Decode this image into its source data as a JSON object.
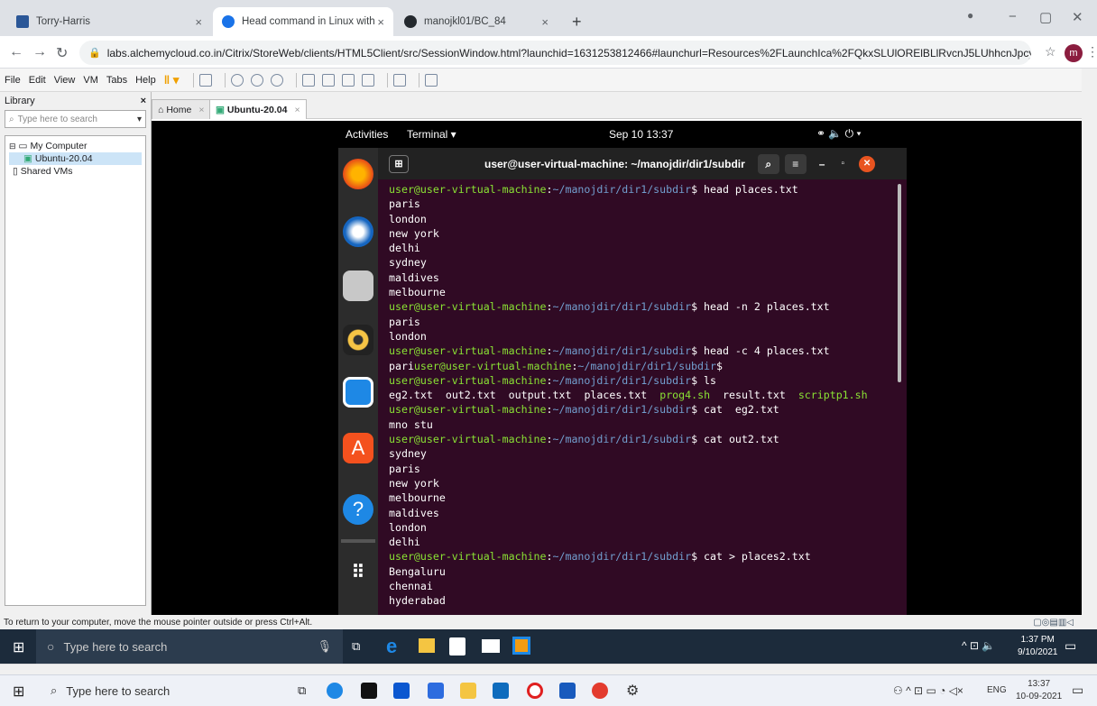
{
  "browser": {
    "tabs": [
      {
        "label": "Torry-Harris",
        "color": "#2b5797"
      },
      {
        "label": "Head command in Linux with exa",
        "color": "#1a73e8"
      },
      {
        "label": "manojkl01/BC_84",
        "color": "#24292e"
      }
    ],
    "new_tab": "+",
    "url": "labs.alchemycloud.co.in/Citrix/StoreWeb/clients/HTML5Client/src/SessionWindow.html?launchid=1631253812466#launchurl=Resources%2FLaunchIca%2FQkxSLUlORElBLlRvcnJ5LUhhcnJpcyAkQTlxLTlxLTFEO...",
    "profile_initial": "m"
  },
  "vmware": {
    "menu": [
      "File",
      "Edit",
      "View",
      "VM",
      "Tabs",
      "Help"
    ],
    "library": {
      "title": "Library",
      "search_placeholder": "Type here to search",
      "tree": [
        "My Computer",
        "Ubuntu-20.04",
        "Shared VMs"
      ]
    },
    "tabs": [
      {
        "label": "Home"
      },
      {
        "label": "Ubuntu-20.04"
      }
    ],
    "status_message": "To return to your computer, move the mouse pointer outside or press Ctrl+Alt."
  },
  "ubuntu": {
    "activities": "Activities",
    "app_menu": "Terminal ▾",
    "clock": "Sep 10  13:37",
    "terminal_title": "user@user-virtual-machine: ~/manojdir/dir1/subdir",
    "prompt_user": "user@user-virtual-machine",
    "prompt_path": "~/manojdir/dir1/subdir",
    "lines": [
      {
        "kind": "prompt",
        "cmd": "head places.txt"
      },
      {
        "kind": "out",
        "text": "paris"
      },
      {
        "kind": "out",
        "text": "london"
      },
      {
        "kind": "out",
        "text": "new york"
      },
      {
        "kind": "out",
        "text": "delhi"
      },
      {
        "kind": "out",
        "text": "sydney"
      },
      {
        "kind": "out",
        "text": "maldives"
      },
      {
        "kind": "out",
        "text": "melbourne"
      },
      {
        "kind": "prompt",
        "cmd": "head -n 2 places.txt"
      },
      {
        "kind": "out",
        "text": "paris"
      },
      {
        "kind": "out",
        "text": "london"
      },
      {
        "kind": "prompt",
        "cmd": "head -c 4 places.txt"
      },
      {
        "kind": "prompt",
        "pre": "pari",
        "cmd": ""
      },
      {
        "kind": "prompt",
        "cmd": "ls"
      },
      {
        "kind": "ls",
        "items": [
          {
            "t": "eg2.txt",
            "exe": false
          },
          {
            "t": "out2.txt",
            "exe": false
          },
          {
            "t": "output.txt",
            "exe": false
          },
          {
            "t": "places.txt",
            "exe": false
          },
          {
            "t": "prog4.sh",
            "exe": true
          },
          {
            "t": "result.txt",
            "exe": false
          },
          {
            "t": "scriptp1.sh",
            "exe": true
          }
        ]
      },
      {
        "kind": "prompt",
        "cmd": "cat  eg2.txt"
      },
      {
        "kind": "out",
        "text": "mno stu"
      },
      {
        "kind": "prompt",
        "cmd": "cat out2.txt"
      },
      {
        "kind": "out",
        "text": "sydney"
      },
      {
        "kind": "out",
        "text": "paris"
      },
      {
        "kind": "out",
        "text": "new york"
      },
      {
        "kind": "out",
        "text": "melbourne"
      },
      {
        "kind": "out",
        "text": "maldives"
      },
      {
        "kind": "out",
        "text": "london"
      },
      {
        "kind": "out",
        "text": "delhi"
      },
      {
        "kind": "prompt",
        "cmd": "cat > places2.txt"
      },
      {
        "kind": "out",
        "text": "Bengaluru"
      },
      {
        "kind": "out",
        "text": "chennai"
      },
      {
        "kind": "out",
        "text": "hyderabad"
      }
    ]
  },
  "inner_taskbar": {
    "search_placeholder": "Type here to search",
    "time": "1:37 PM",
    "date": "9/10/2021"
  },
  "outer_taskbar": {
    "search_placeholder": "Type here to search",
    "language": "ENG",
    "time": "13:37",
    "date": "10-09-2021"
  }
}
